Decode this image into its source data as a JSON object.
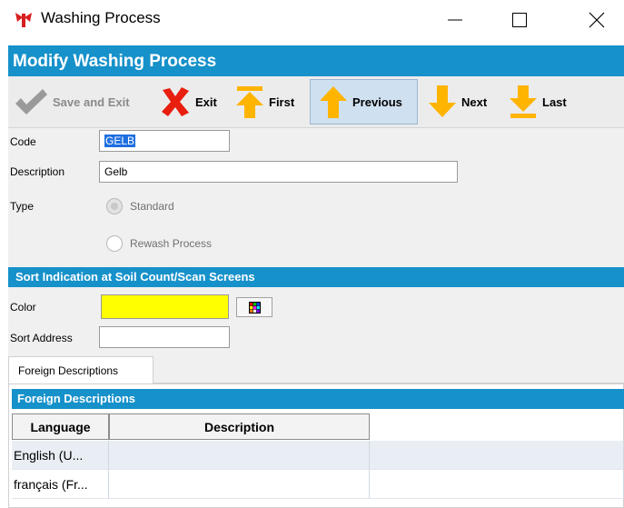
{
  "window": {
    "title": "Washing Process",
    "controls": {
      "minimize": "minimize-icon",
      "maximize": "maximize-icon",
      "close": "close-icon"
    }
  },
  "header": {
    "title": "Modify Washing Process"
  },
  "toolbar": {
    "save_exit": "Save and Exit",
    "exit": "Exit",
    "first": "First",
    "previous": "Previous",
    "next": "Next",
    "last": "Last"
  },
  "form": {
    "code_label": "Code",
    "code_value": "GELB",
    "description_label": "Description",
    "description_value": "Gelb",
    "type_label": "Type",
    "type_options": [
      "Standard",
      "Rewash Process"
    ]
  },
  "sort_section": {
    "title": "Sort Indication at Soil Count/Scan Screens",
    "color_label": "Color",
    "color_value": "#ffff00",
    "sort_address_label": "Sort Address",
    "sort_address_value": ""
  },
  "tabs": [
    "Foreign Descriptions"
  ],
  "foreign_grid": {
    "title": "Foreign Descriptions",
    "columns": [
      "Language",
      "Description"
    ],
    "rows": [
      {
        "language": "English (U...",
        "description": ""
      },
      {
        "language": "français (Fr...",
        "description": ""
      }
    ]
  },
  "colors": {
    "accent": "#1691ca",
    "selection": "#1f6fe0"
  }
}
